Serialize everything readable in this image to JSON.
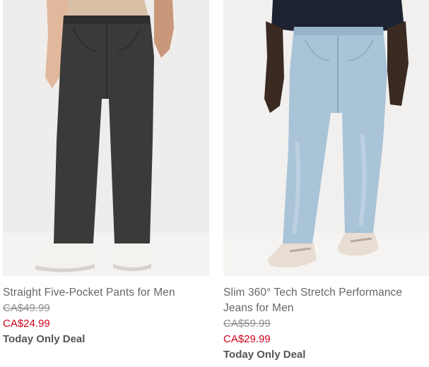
{
  "products": [
    {
      "title": "Straight Five-Pocket Pants for Men",
      "original_price": "CA$49.99",
      "sale_price": "CA$24.99",
      "promo": "Today Only Deal"
    },
    {
      "title": "Slim 360° Tech Stretch Performance Jeans for Men",
      "original_price": "CA$59.99",
      "sale_price": "CA$29.99",
      "promo": "Today Only Deal"
    }
  ],
  "colors": {
    "sale_price": "#d0021b",
    "text": "#666666",
    "strike": "#8a8a8a"
  }
}
